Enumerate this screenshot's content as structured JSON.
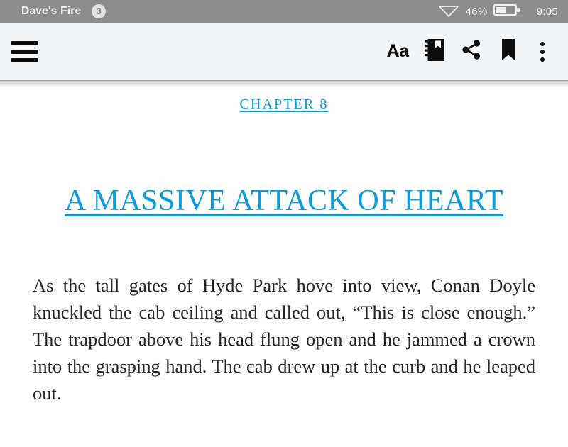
{
  "status_bar": {
    "app_title": "Dave's Fire",
    "notification_count": "3",
    "wifi_icon": "wifi-icon",
    "battery_percent": "46%",
    "battery_icon": "battery-icon",
    "clock": "9:05",
    "background_color": "#8c8c8c",
    "text_color": "#f2f2f2"
  },
  "toolbar": {
    "menu_icon": "hamburger-menu-icon",
    "font_size_label": "Aa",
    "notebook_icon": "notebook-icon",
    "share_icon": "share-icon",
    "bookmark_icon": "bookmark-icon",
    "overflow_icon": "overflow-menu-icon",
    "background_color": "#f4f5f7"
  },
  "reader": {
    "chapter_label": "CHAPTER  8",
    "chapter_title": "A MASSIVE ATTACK OF HEART",
    "body_paragraph": "As the tall gates of Hyde Park hove into view, Conan Doyle knuckled the cab ceiling and called out, “This is close enough.” The trapdoor above his head flung open and he jammed a crown into the grasping hand. The cab drew up at the curb and he leaped out.",
    "accent_color": "#0d9cd9",
    "text_color": "#262626",
    "page_background": "#ffffff"
  }
}
